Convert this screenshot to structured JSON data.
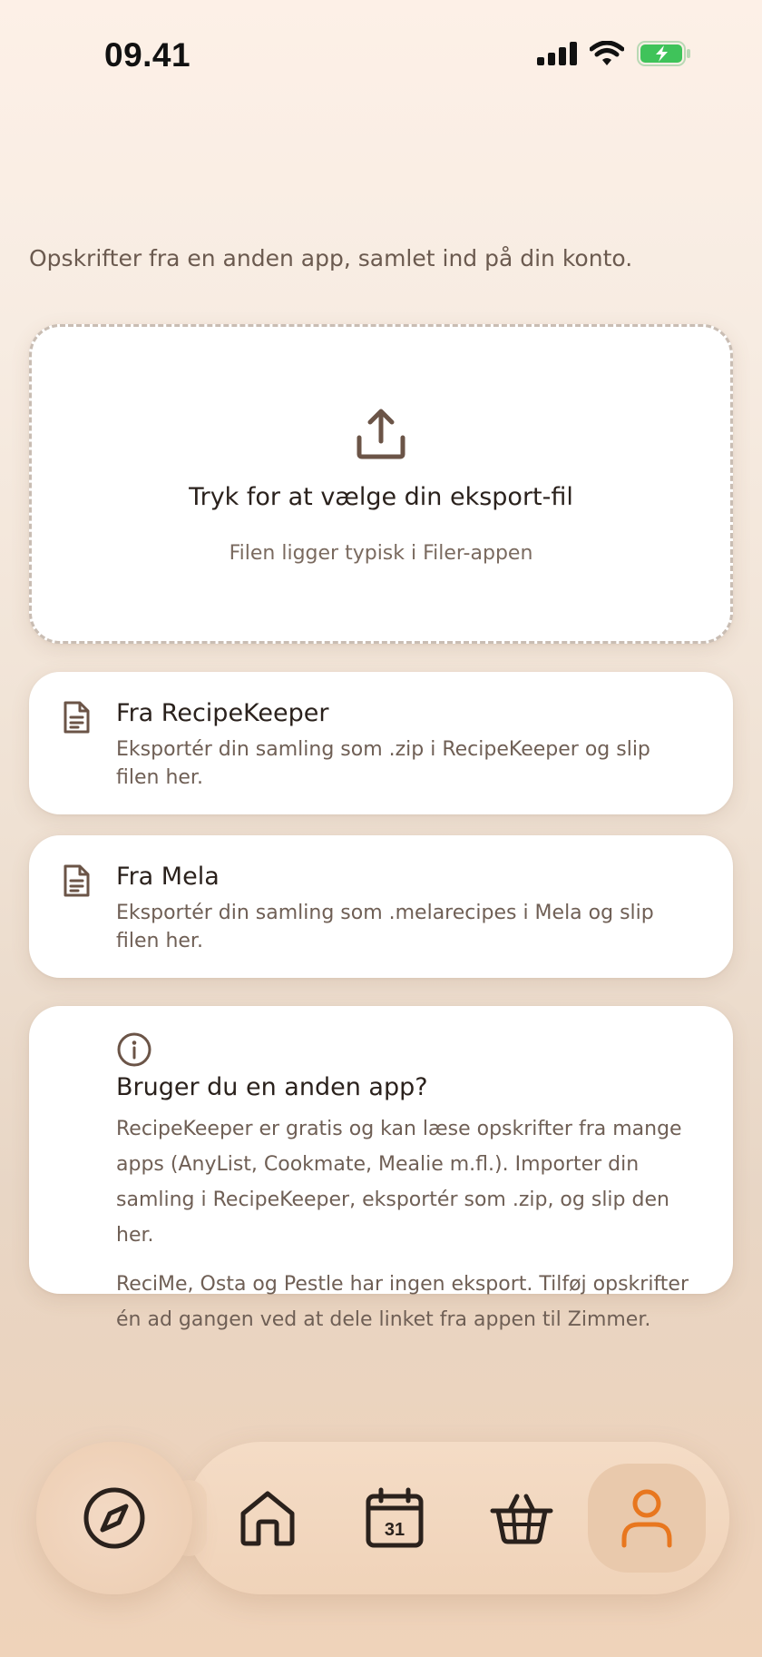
{
  "status_bar": {
    "time": "09.41"
  },
  "intro": {
    "text": "Opskrifter fra en anden app, samlet ind på din konto."
  },
  "upload": {
    "title": "Tryk for at vælge din eksport-fil",
    "hint": "Filen ligger typisk i Filer-appen",
    "icon": "upload-icon"
  },
  "sources": [
    {
      "title": "Fra RecipeKeeper",
      "description": "Eksportér din samling som .zip i RecipeKeeper og slip filen her.",
      "icon": "document-icon"
    },
    {
      "title": "Fra Mela",
      "description": "Eksportér din samling som .melarecipes i Mela og slip filen her.",
      "icon": "document-icon"
    }
  ],
  "info": {
    "title": "Bruger du en anden app?",
    "paragraph_1": "RecipeKeeper er gratis og kan læse opskrifter fra mange apps (AnyList, Cookmate, Mealie m.fl.). Importer din samling i RecipeKeeper, eksportér som .zip, og slip den her.",
    "paragraph_2": "ReciMe, Osta og Pestle har ingen eksport. Tilføj opskrifter én ad gangen ved at dele linket fra appen til Zimmer.",
    "icon": "info-icon"
  },
  "tab_bar": {
    "calendar_day": "31",
    "active_tab": "profile",
    "active_color": "#e8771f",
    "icon_color": "#2a211c"
  }
}
